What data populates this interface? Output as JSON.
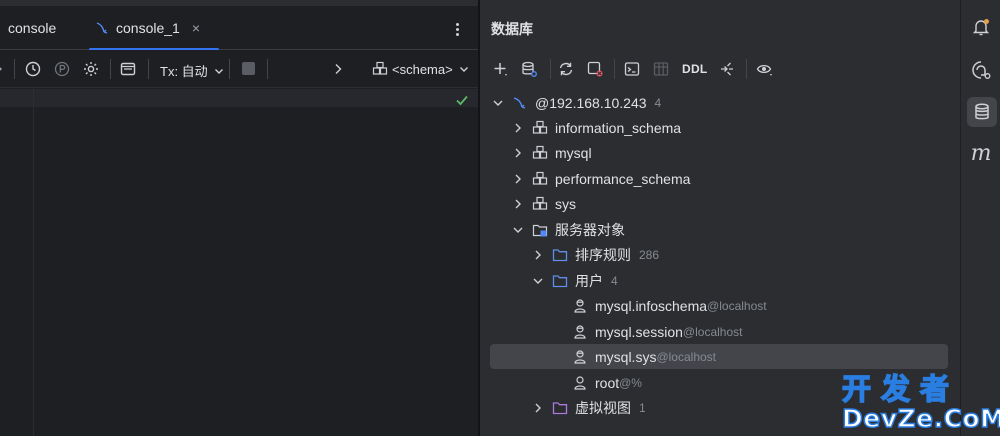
{
  "editor": {
    "tabs": [
      {
        "label": "console"
      },
      {
        "label": "console_1",
        "close": "×"
      }
    ],
    "toolbar": {
      "tx_label": "Tx: 自动",
      "schema_label": "<schema>",
      "icons": [
        "history-icon",
        "explain-plan-icon",
        "settings-icon",
        "output-icon",
        "stop-icon",
        "chevron-right-icon",
        "schema-icon"
      ]
    }
  },
  "database": {
    "title": "数据库",
    "toolbar": {
      "ddl_label": "DDL",
      "icons": [
        "add-icon",
        "data-source-properties-icon",
        "refresh-icon",
        "stop-icon",
        "console-icon",
        "table-icon",
        "jump-icon",
        "view-icon"
      ]
    },
    "tree": [
      {
        "label": "@192.168.10.243",
        "count": "4",
        "icon": "mysql-icon",
        "expanded": true,
        "level": 0
      },
      {
        "label": "information_schema",
        "icon": "schema-icon",
        "expanded": false,
        "level": 1
      },
      {
        "label": "mysql",
        "icon": "schema-icon",
        "expanded": false,
        "level": 1
      },
      {
        "label": "performance_schema",
        "icon": "schema-icon",
        "expanded": false,
        "level": 1
      },
      {
        "label": "sys",
        "icon": "schema-icon",
        "expanded": false,
        "level": 1
      },
      {
        "label": "服务器对象",
        "icon": "server-objects-icon",
        "expanded": true,
        "level": 1
      },
      {
        "label": "排序规则",
        "count": "286",
        "icon": "folder-icon",
        "expanded": false,
        "level": 2
      },
      {
        "label": "用户",
        "count": "4",
        "icon": "folder-icon",
        "expanded": true,
        "level": 2
      },
      {
        "label": "mysql.infoschema",
        "host": "@localhost",
        "icon": "user-icon",
        "level": 3
      },
      {
        "label": "mysql.session",
        "host": "@localhost",
        "icon": "user-icon",
        "level": 3
      },
      {
        "label": "mysql.sys",
        "host": "@localhost",
        "icon": "user-icon",
        "level": 3,
        "selected": true
      },
      {
        "label": "root",
        "host": "@%",
        "icon": "user-icon",
        "level": 3
      },
      {
        "label": "虚拟视图",
        "count": "1",
        "icon": "folder-purple-icon",
        "expanded": false,
        "level": 2
      }
    ]
  },
  "sidebar": {
    "items": [
      "notifications-icon",
      "ai-assistant-icon",
      "database-icon",
      "m-icon"
    ],
    "m_letter": "m"
  },
  "watermark": {
    "cn": "开发者",
    "en": "DevZe.CoM"
  },
  "colors": {
    "accent": "#3574f0",
    "selection": "#43454a",
    "folder": "#5e8ee6",
    "folder_purple": "#a87ad9",
    "success": "#5fb865"
  }
}
